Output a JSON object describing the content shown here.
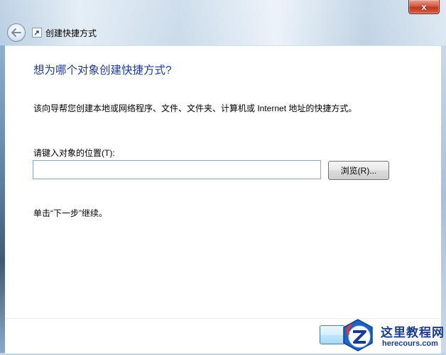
{
  "window": {
    "title": "创建快捷方式",
    "close_label": "x"
  },
  "page": {
    "heading": "想为哪个对象创建快捷方式?",
    "description": "该向导帮您创建本地或网络程序、文件、文件夹、计算机或 Internet 地址的快捷方式。",
    "location_label": "请键入对象的位置(T):",
    "location_value": "",
    "browse_label": "浏览(R)...",
    "hint": "单击“下一步”继续。"
  },
  "watermark": {
    "title": "这里教程网",
    "url": "herecours.com"
  },
  "icons": {
    "back": "back-arrow-icon",
    "wizard": "shortcut-wizard-icon",
    "close": "close-icon"
  },
  "colors": {
    "heading": "#1e3d8f",
    "close_button": "#c0371f"
  }
}
